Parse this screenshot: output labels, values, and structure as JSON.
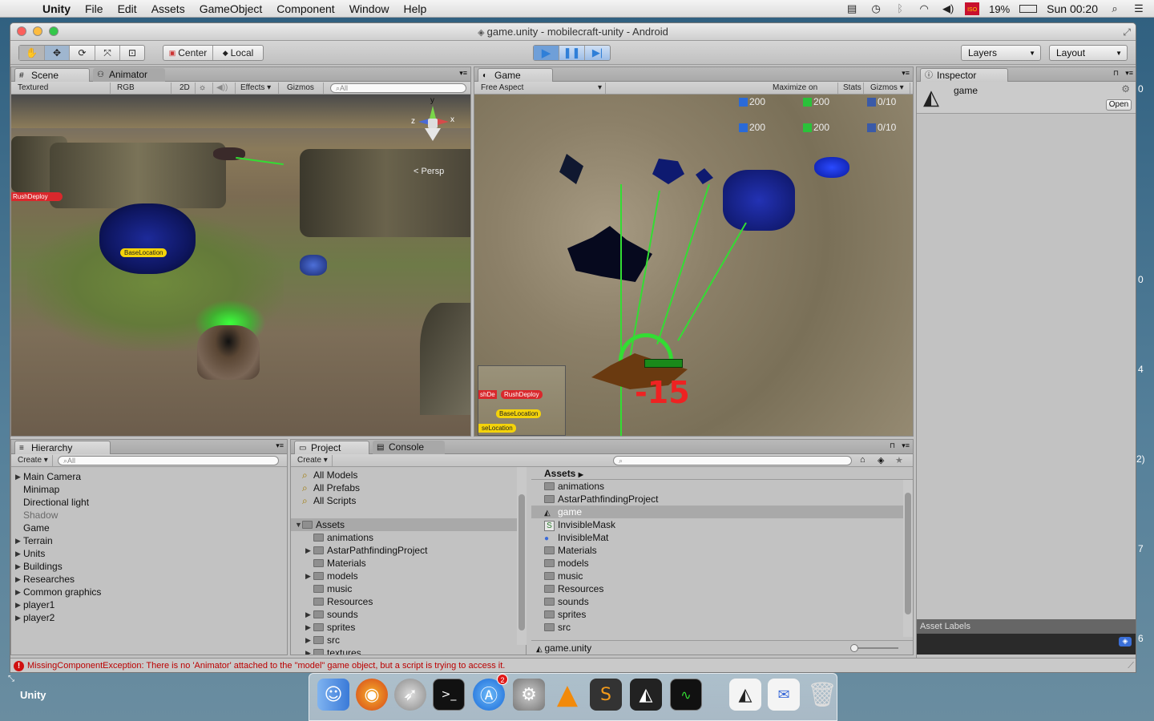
{
  "menubar": {
    "app": "Unity",
    "items": [
      "File",
      "Edit",
      "Assets",
      "GameObject",
      "Component",
      "Window",
      "Help"
    ],
    "battery": "19%",
    "clock": "Sun 00:20",
    "flag_text": "ISO"
  },
  "window": {
    "title": "game.unity - mobilecraft-unity - Android"
  },
  "toolbar": {
    "pivot": "Center",
    "space": "Local",
    "layers": "Layers",
    "layout": "Layout"
  },
  "scene": {
    "tabs": [
      "Scene",
      "Animator"
    ],
    "render_mode": "Textured",
    "color_mode": "RGB",
    "mode_2d": "2D",
    "effects": "Effects",
    "gizmos": "Gizmos",
    "search_placeholder": "All",
    "persp": "< Persp",
    "axis_y": "y",
    "axis_x": "x",
    "axis_z": "z",
    "labels": [
      "RushDeploy",
      "BaseLocation"
    ]
  },
  "game": {
    "tab": "Game",
    "aspect": "Free Aspect",
    "maximize": "Maximize on Play",
    "stats": "Stats",
    "gizmos": "Gizmos",
    "resources_row1": [
      "200",
      "200",
      "0/10"
    ],
    "resources_row2": [
      "200",
      "200",
      "0/10"
    ],
    "damage": "-15",
    "minimap_labels": [
      "shDe",
      "RushDeploy",
      "BaseLocation",
      "seLocation"
    ]
  },
  "inspector": {
    "tab": "Inspector",
    "object": "game",
    "open_button": "Open",
    "asset_labels": "Asset Labels"
  },
  "hierarchy": {
    "tab": "Hierarchy",
    "create": "Create",
    "search_placeholder": "All",
    "items": [
      {
        "label": "Main Camera",
        "arrow": "▶",
        "dim": false
      },
      {
        "label": "Minimap",
        "arrow": "",
        "dim": false
      },
      {
        "label": "Directional light",
        "arrow": "",
        "dim": false
      },
      {
        "label": "Shadow",
        "arrow": "",
        "dim": true
      },
      {
        "label": "Game",
        "arrow": "",
        "dim": false
      },
      {
        "label": "Terrain",
        "arrow": "▶",
        "dim": false
      },
      {
        "label": "Units",
        "arrow": "▶",
        "dim": false
      },
      {
        "label": "Buildings",
        "arrow": "▶",
        "dim": false
      },
      {
        "label": "Researches",
        "arrow": "▶",
        "dim": false
      },
      {
        "label": "Common graphics",
        "arrow": "▶",
        "dim": false
      },
      {
        "label": "player1",
        "arrow": "▶",
        "dim": false
      },
      {
        "label": "player2",
        "arrow": "▶",
        "dim": false
      }
    ]
  },
  "project": {
    "tabs": [
      "Project",
      "Console"
    ],
    "create": "Create",
    "favorites": [
      "All Models",
      "All Prefabs",
      "All Scripts"
    ],
    "tree_root": "Assets",
    "tree": [
      {
        "label": "animations",
        "arrow": ""
      },
      {
        "label": "AstarPathfindingProject",
        "arrow": "▶"
      },
      {
        "label": "Materials",
        "arrow": ""
      },
      {
        "label": "models",
        "arrow": "▶"
      },
      {
        "label": "music",
        "arrow": ""
      },
      {
        "label": "Resources",
        "arrow": ""
      },
      {
        "label": "sounds",
        "arrow": "▶"
      },
      {
        "label": "sprites",
        "arrow": "▶"
      },
      {
        "label": "src",
        "arrow": "▶"
      },
      {
        "label": "textures",
        "arrow": "▶"
      }
    ],
    "breadcrumb": "Assets",
    "assets": [
      {
        "label": "animations",
        "icon": "folder",
        "sel": false
      },
      {
        "label": "AstarPathfindingProject",
        "icon": "folder",
        "sel": false
      },
      {
        "label": "game",
        "icon": "unity",
        "sel": true
      },
      {
        "label": "InvisibleMask",
        "icon": "script",
        "sel": false
      },
      {
        "label": "InvisibleMat",
        "icon": "material",
        "sel": false
      },
      {
        "label": "Materials",
        "icon": "folder",
        "sel": false
      },
      {
        "label": "models",
        "icon": "folder",
        "sel": false
      },
      {
        "label": "music",
        "icon": "folder",
        "sel": false
      },
      {
        "label": "Resources",
        "icon": "folder",
        "sel": false
      },
      {
        "label": "sounds",
        "icon": "folder",
        "sel": false
      },
      {
        "label": "sprites",
        "icon": "folder",
        "sel": false
      },
      {
        "label": "src",
        "icon": "folder",
        "sel": false
      }
    ],
    "selected_file": "game.unity"
  },
  "status": {
    "message": "MissingComponentException: There is no 'Animator' attached to the \"model\" game object, but a script is trying to access it."
  },
  "desktop": {
    "label": "Unity",
    "edge_digits": [
      "0",
      "0",
      "4",
      "2)",
      "7",
      "6"
    ]
  },
  "dock": {
    "items": [
      "finder-icon",
      "firefox-icon",
      "launchpad-icon",
      "terminal-icon",
      "app-store-icon",
      "system-preferences-icon",
      "vlc-icon",
      "sublime-text-icon",
      "unity-icon",
      "activity-monitor-icon",
      "unity-doc-icon",
      "mail-icon",
      "trash-icon"
    ],
    "badge": "2"
  },
  "colors": {
    "play_blue": "#2f7fd8",
    "selection": "#a9a9a9",
    "error_red": "#b00000",
    "green_line": "#33dd33"
  }
}
